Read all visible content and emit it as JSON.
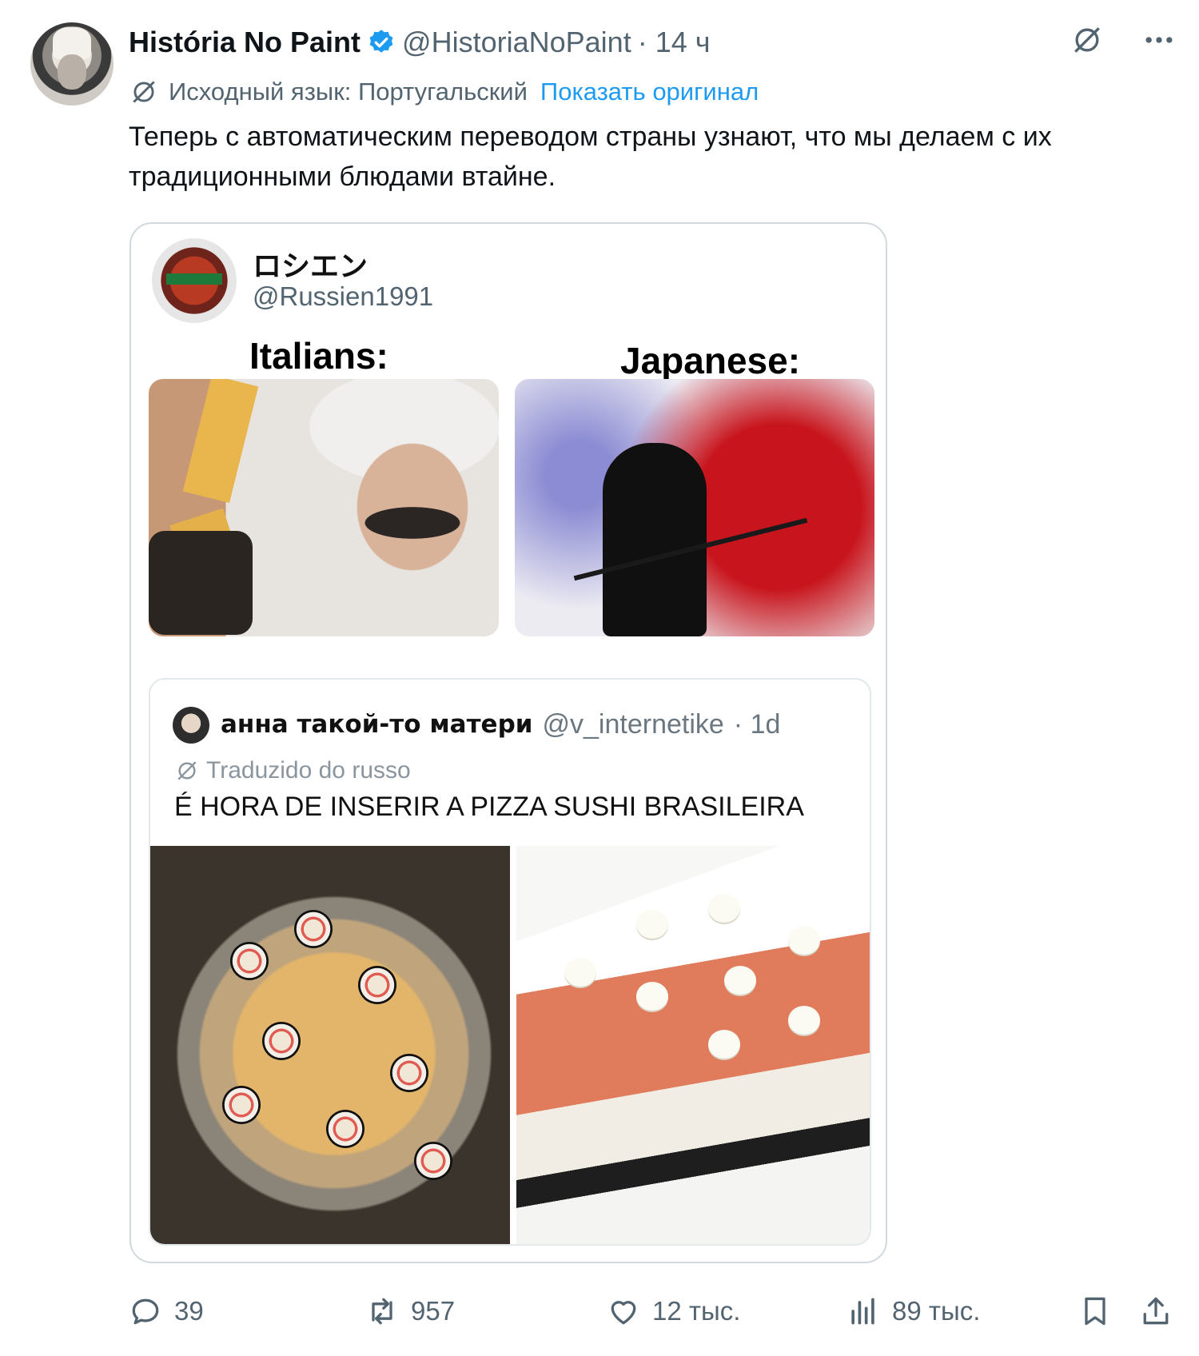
{
  "tweet": {
    "display_name": "História No Paint",
    "handle": "@HistoriaNoPaint",
    "time": "· 14 ч",
    "translation": {
      "source_label": "Исходный язык: Португальский",
      "show_original": "Показать оригинал"
    },
    "text": "Теперь с автоматическим переводом страны узнают, что мы делаем с их традиционными блюдами втайне."
  },
  "inner_post": {
    "name": "ロシエン",
    "handle": "@Russien1991",
    "meme": {
      "left_label": "Italians:",
      "right_label": "Japanese:"
    }
  },
  "quoted_post": {
    "name": "анна такой-то матери",
    "handle": "@v_internetike",
    "time": "· 1d",
    "translated_label": "Traduzido do russo",
    "text": "É HORA DE INSERIR A PIZZA SUSHI BRASILEIRA"
  },
  "actions": {
    "replies": "39",
    "reposts": "957",
    "likes": "12 тыс.",
    "views": "89 тыс."
  },
  "icons": {
    "verified": "verified-badge-icon",
    "translate": "translate-icon",
    "more": "more-icon",
    "reply": "reply-icon",
    "repost": "repost-icon",
    "like": "heart-icon",
    "views": "views-icon",
    "bookmark": "bookmark-icon",
    "share": "share-icon"
  },
  "colors": {
    "accent": "#1d9bf0",
    "muted": "#536471",
    "text": "#0f1419"
  }
}
